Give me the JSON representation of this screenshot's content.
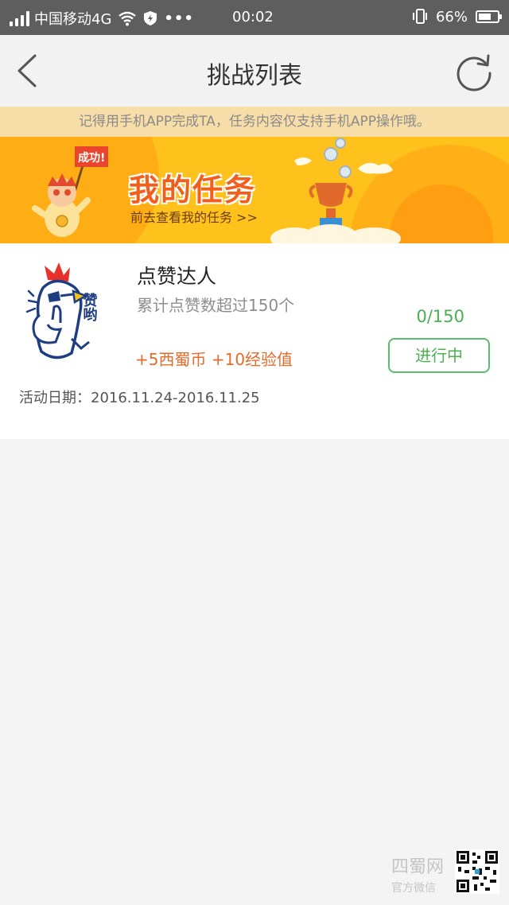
{
  "status_bar": {
    "carrier": "中国移动4G",
    "dots": "•••",
    "time": "00:02",
    "battery": "66%",
    "battery_level": 0.66
  },
  "header": {
    "title": "挑战列表",
    "back_icon": "chevron-left-icon",
    "refresh_icon": "refresh-icon"
  },
  "notice": {
    "text": "记得用手机APP完成TA，任务内容仅支持手机APP操作哦。"
  },
  "banner": {
    "badge": "成功!",
    "title": "我的任务",
    "subtitle": "前去查看我的任务 >>"
  },
  "task": {
    "icon_text": "赞哟",
    "name": "点赞达人",
    "description": "累计点赞数超过150个",
    "reward": "+5西蜀币 +10经验值",
    "progress": "0/150",
    "status": "进行中",
    "date": "活动日期：2016.11.24-2016.11.25"
  },
  "watermark": {
    "name": "四蜀网",
    "sub": "官方微信"
  },
  "colors": {
    "status_bar": "#5e5e5e",
    "banner": "#ffc21c",
    "accent_green": "#4caf50",
    "reward_orange": "#e56b2b"
  }
}
